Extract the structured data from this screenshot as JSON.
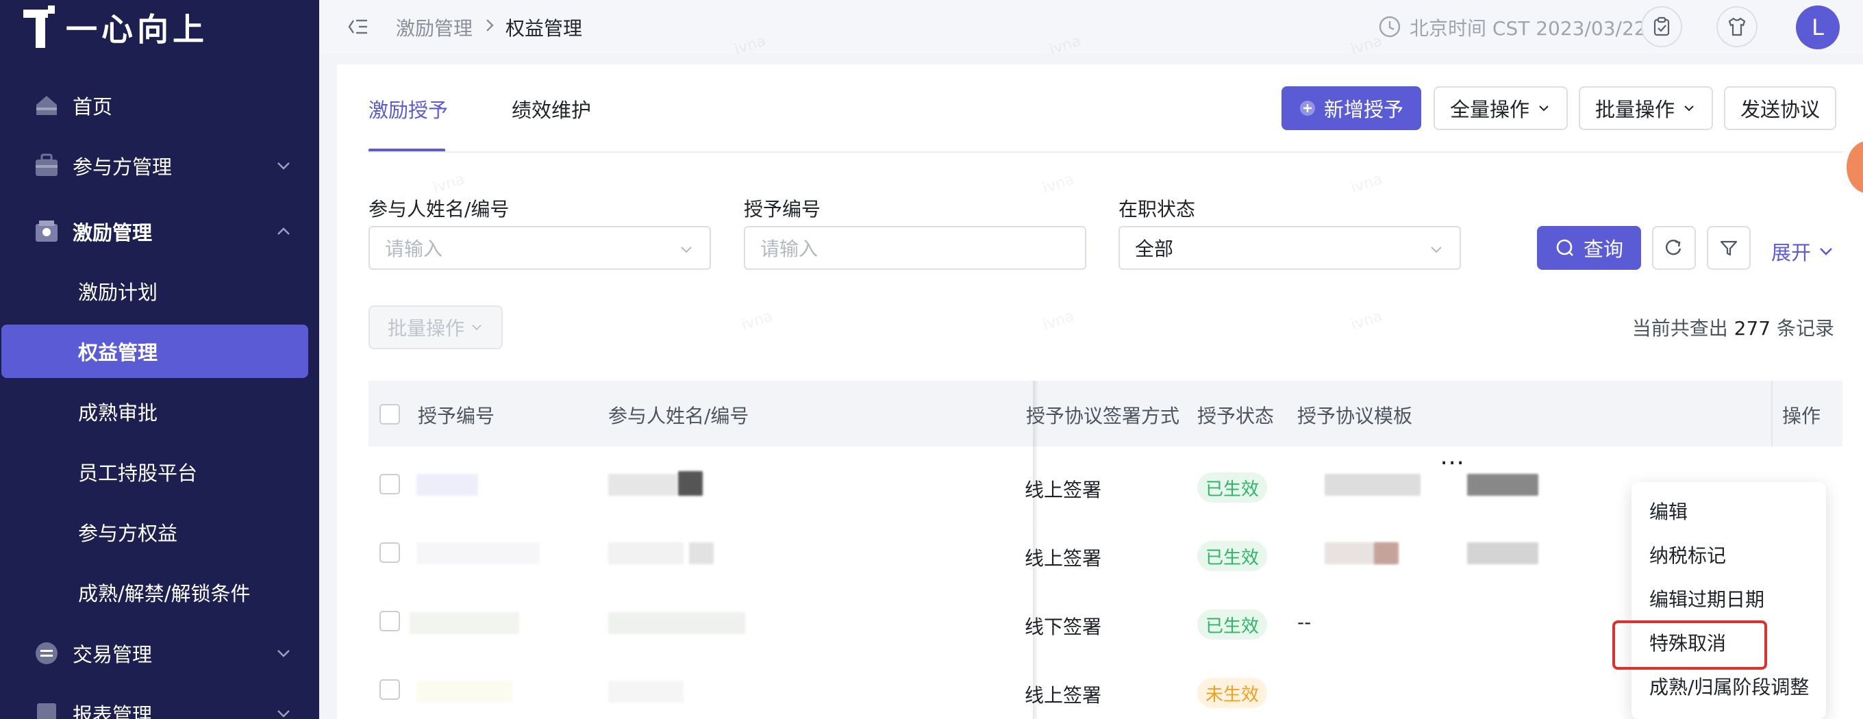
{
  "app": {
    "logo_text": "一心向上"
  },
  "sidebar": {
    "items": [
      {
        "label": "首页"
      },
      {
        "label": "参与方管理"
      },
      {
        "label": "激励管理"
      },
      {
        "label": "交易管理"
      },
      {
        "label": "报表管理"
      }
    ],
    "sub_items": [
      {
        "label": "激励计划"
      },
      {
        "label": "权益管理"
      },
      {
        "label": "成熟审批"
      },
      {
        "label": "员工持股平台"
      },
      {
        "label": "参与方权益"
      },
      {
        "label": "成熟/解禁/解锁条件"
      }
    ]
  },
  "header": {
    "breadcrumb_parent": "激励管理",
    "breadcrumb_current": "权益管理",
    "time_text": "北京时间 CST 2023/03/22",
    "avatar_letter": "L"
  },
  "tabs": [
    {
      "label": "激励授予"
    },
    {
      "label": "绩效维护"
    }
  ],
  "toolbar": {
    "add_label": "新增授予",
    "all_ops_label": "全量操作",
    "batch_ops_label": "批量操作",
    "send_label": "发送协议"
  },
  "filters": {
    "name_label": "参与人姓名/编号",
    "name_placeholder": "请输入",
    "grant_no_label": "授予编号",
    "grant_no_placeholder": "请输入",
    "status_label": "在职状态",
    "status_value": "全部",
    "query_label": "查询",
    "expand_label": "展开"
  },
  "list": {
    "batch_label": "批量操作",
    "count_prefix": "当前共查出",
    "count_value": "277",
    "count_suffix": "条记录"
  },
  "table": {
    "headers": {
      "grant_no": "授予编号",
      "participant": "参与人姓名/编号",
      "sign_method": "授予协议签署方式",
      "grant_status": "授予状态",
      "template": "授予协议模板",
      "actions": "操作"
    },
    "rows": [
      {
        "sign_method": "线上签署",
        "status": "已生效",
        "template": ""
      },
      {
        "sign_method": "线上签署",
        "status": "已生效",
        "template": ""
      },
      {
        "sign_method": "线下签署",
        "status": "已生效",
        "template": "--"
      },
      {
        "sign_method": "线上签署",
        "status": "未生效",
        "template": ""
      }
    ]
  },
  "action_menu": {
    "items": [
      {
        "label": "编辑"
      },
      {
        "label": "纳税标记"
      },
      {
        "label": "编辑过期日期"
      },
      {
        "label": "特殊取消"
      },
      {
        "label": "成熟/归属阶段调整"
      }
    ]
  },
  "watermark_text": "ivna",
  "colors": {
    "accent": "#5b5bd6",
    "sidebar": "#1c1f4f",
    "success": "#2fb46a",
    "warning": "#f0a020",
    "highlight": "#e02f2f"
  }
}
